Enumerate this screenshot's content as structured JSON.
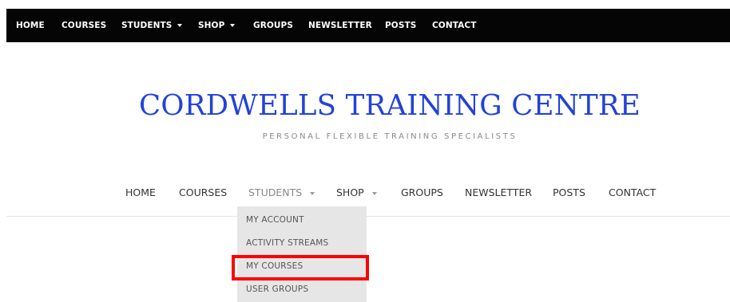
{
  "top_nav": {
    "items": [
      {
        "label": "HOME",
        "has_dropdown": false
      },
      {
        "label": "COURSES",
        "has_dropdown": false
      },
      {
        "label": "STUDENTS",
        "has_dropdown": true
      },
      {
        "label": "SHOP",
        "has_dropdown": true
      },
      {
        "label": "GROUPS",
        "has_dropdown": false
      },
      {
        "label": "NEWSLETTER",
        "has_dropdown": false
      },
      {
        "label": "POSTS",
        "has_dropdown": false
      },
      {
        "label": "CONTACT",
        "has_dropdown": false
      }
    ]
  },
  "header": {
    "site_title": "CORDWELLS TRAINING CENTRE",
    "tagline": "PERSONAL FLEXIBLE TRAINING SPECIALISTS"
  },
  "main_nav": {
    "items": [
      {
        "label": "HOME",
        "has_dropdown": false
      },
      {
        "label": "COURSES",
        "has_dropdown": false
      },
      {
        "label": "STUDENTS",
        "has_dropdown": true,
        "state": "open"
      },
      {
        "label": "SHOP",
        "has_dropdown": true
      },
      {
        "label": "GROUPS",
        "has_dropdown": false
      },
      {
        "label": "NEWSLETTER",
        "has_dropdown": false
      },
      {
        "label": "POSTS",
        "has_dropdown": false
      },
      {
        "label": "CONTACT",
        "has_dropdown": false
      }
    ]
  },
  "students_dropdown": {
    "items": [
      {
        "label": "MY ACCOUNT"
      },
      {
        "label": "ACTIVITY STREAMS"
      },
      {
        "label": "MY COURSES",
        "highlighted": true
      },
      {
        "label": "USER GROUPS"
      }
    ]
  },
  "colors": {
    "top_bar_bg": "#050505",
    "title_blue": "#2342d9",
    "dropdown_bg": "#e6e6e6",
    "highlight_red": "#ff0000"
  }
}
